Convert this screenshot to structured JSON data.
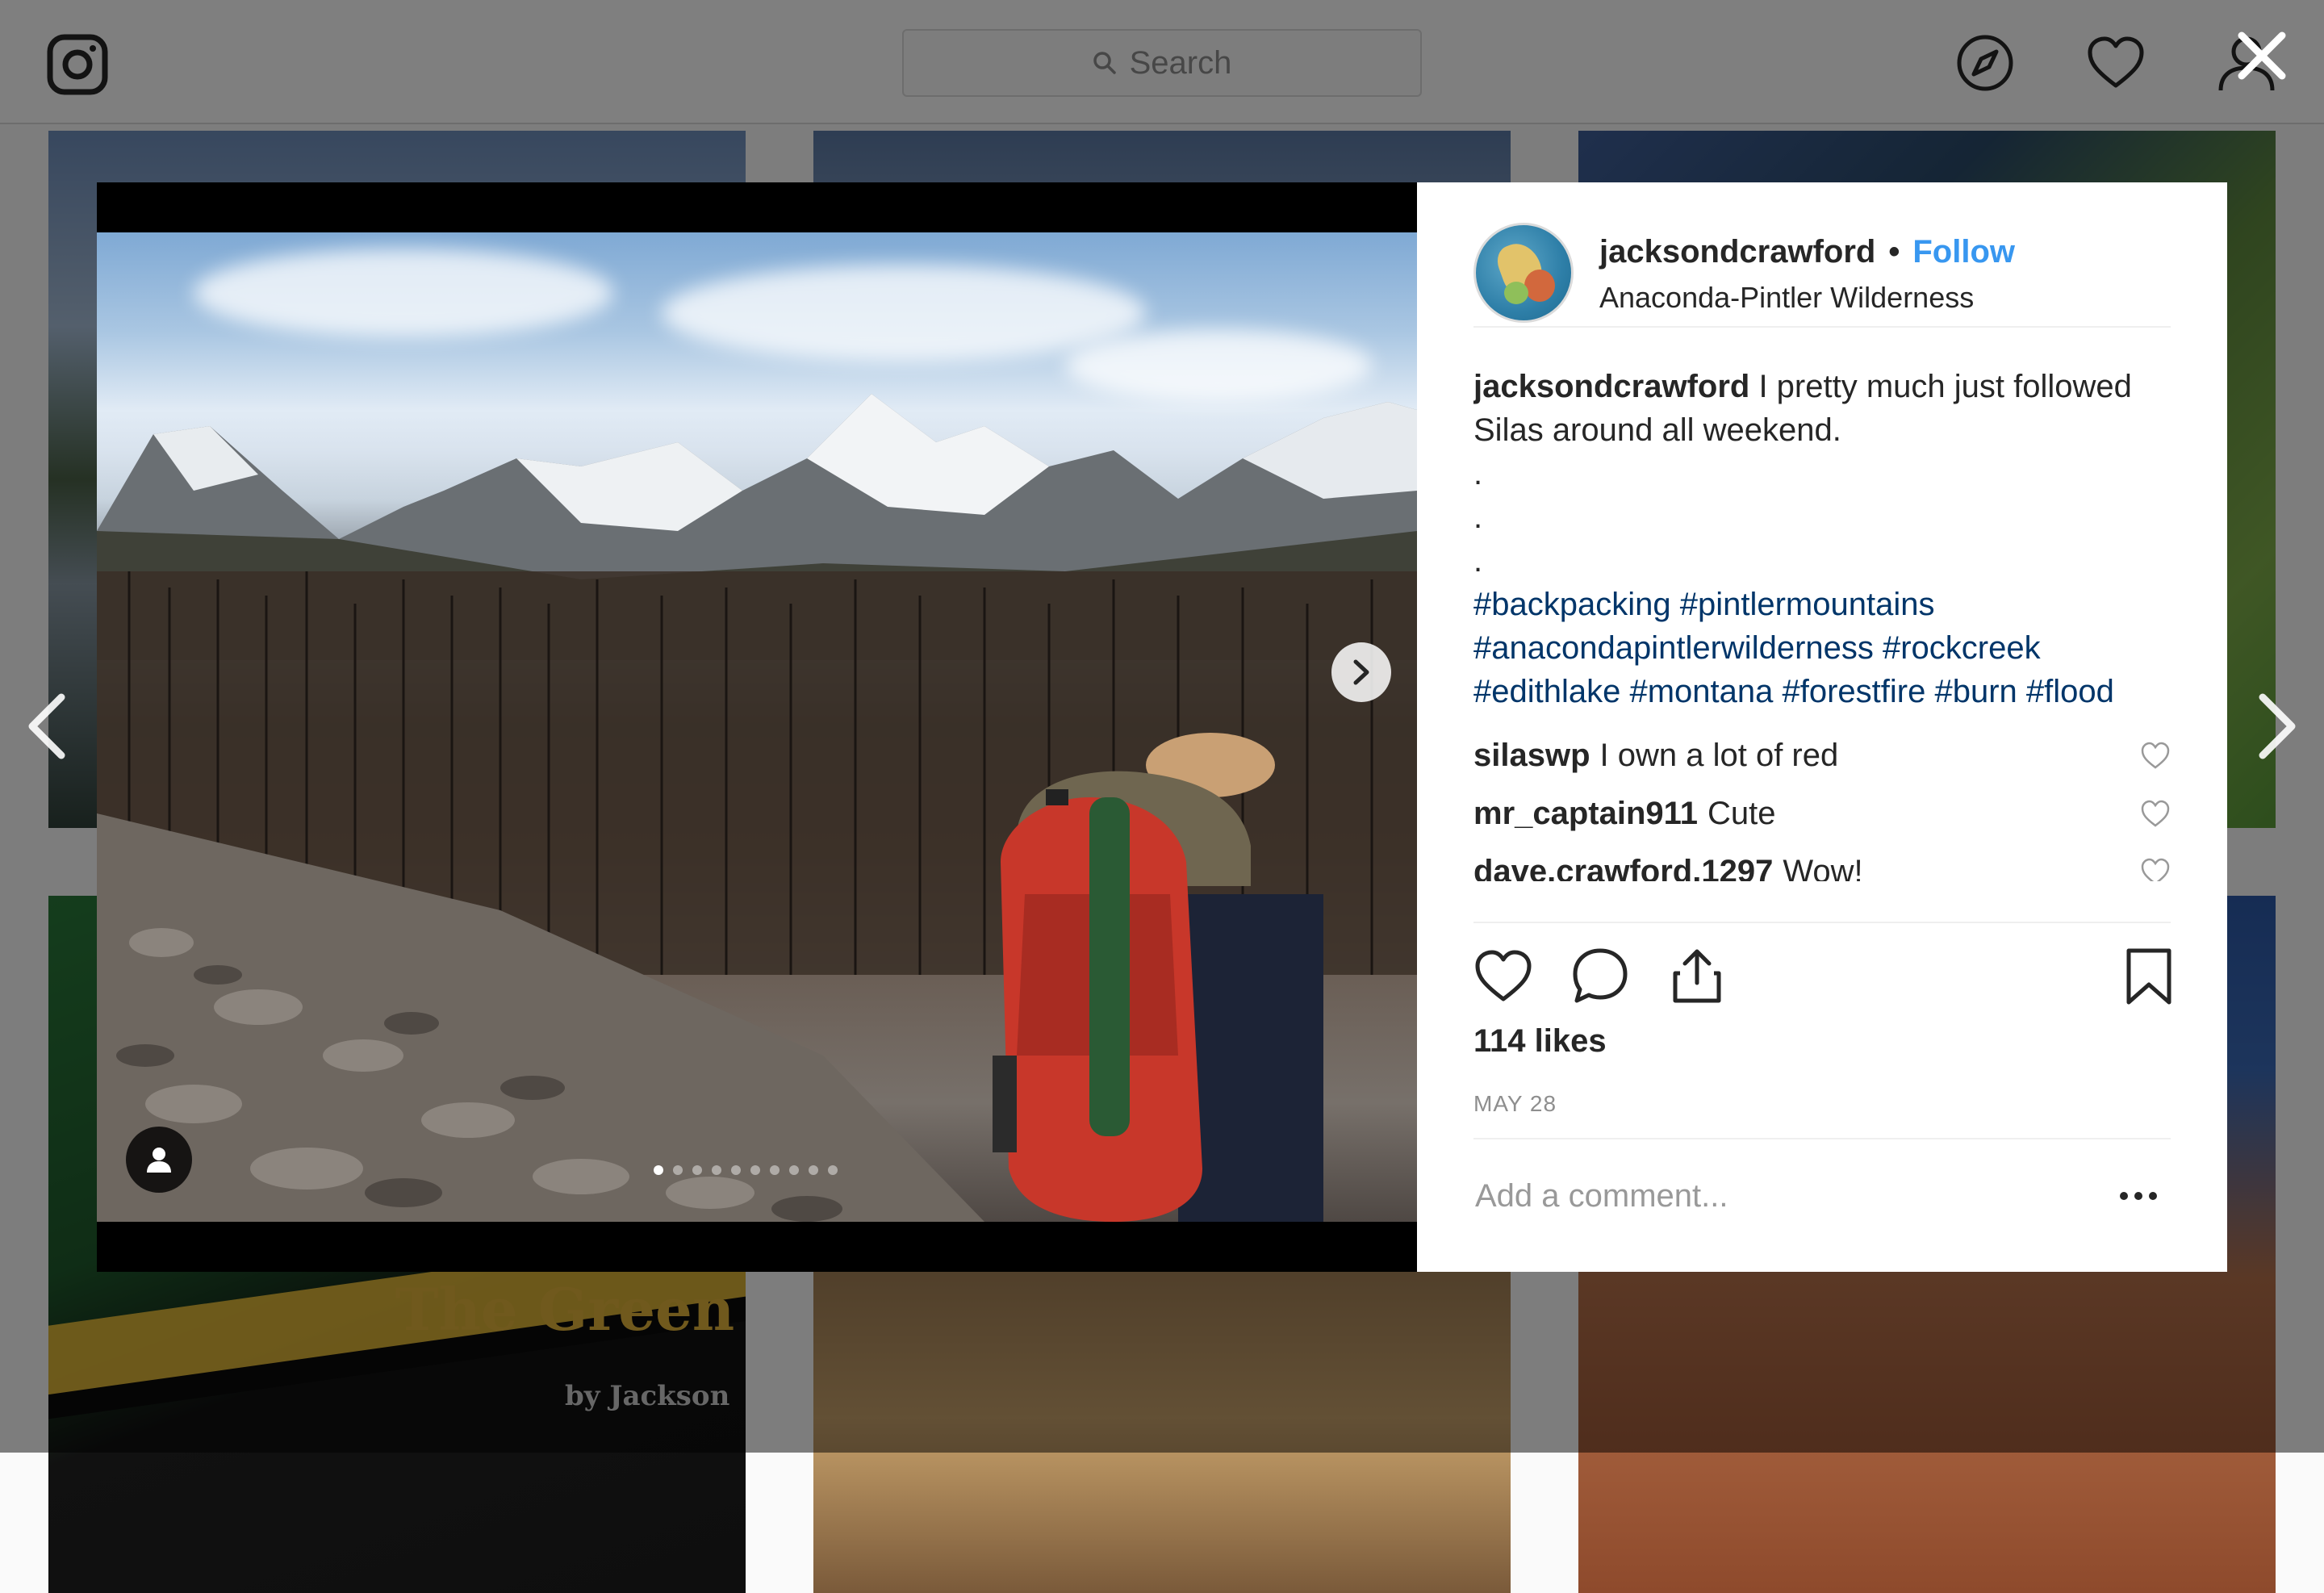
{
  "nav": {
    "search_placeholder": "Search"
  },
  "background_tiles": {
    "tile4_title": "The Green",
    "tile4_subtitle": "by Jackson"
  },
  "post": {
    "username": "jacksondcrawford",
    "separator": "•",
    "follow_label": "Follow",
    "location": "Anaconda-Pintler Wilderness",
    "caption": {
      "user": "jacksondcrawford",
      "text": "I pretty much just followed Silas around all weekend.",
      "dots": [
        ".",
        ".",
        "."
      ],
      "hashtags": "#backpacking #pintlermountains #anacondapintlerwilderness #rockcreek #edithlake #montana #forestfire #burn #flood"
    },
    "comments": [
      {
        "user": "silaswp",
        "text": "I own a lot of red"
      },
      {
        "user": "mr_captain911",
        "text": "Cute"
      },
      {
        "user": "dave.crawford.1297",
        "text": "Wow!"
      }
    ],
    "likes_text": "114 likes",
    "date": "MAY 28",
    "add_comment_placeholder": "Add a comment...",
    "carousel": {
      "total": 10,
      "active": 1
    }
  },
  "colors": {
    "link_blue": "#3897f0",
    "hashtag_blue": "#003569",
    "text_dark": "#262626",
    "muted": "#8e8e8e"
  },
  "icons": {
    "nav": [
      "instagram-logo-icon",
      "search-icon",
      "compass-icon",
      "heart-icon",
      "profile-icon"
    ],
    "overlay": [
      "close-icon",
      "chevron-left-icon",
      "chevron-right-icon"
    ],
    "actions": [
      "like-heart-icon",
      "comment-bubble-icon",
      "share-icon",
      "bookmark-icon",
      "more-dots-icon"
    ]
  }
}
